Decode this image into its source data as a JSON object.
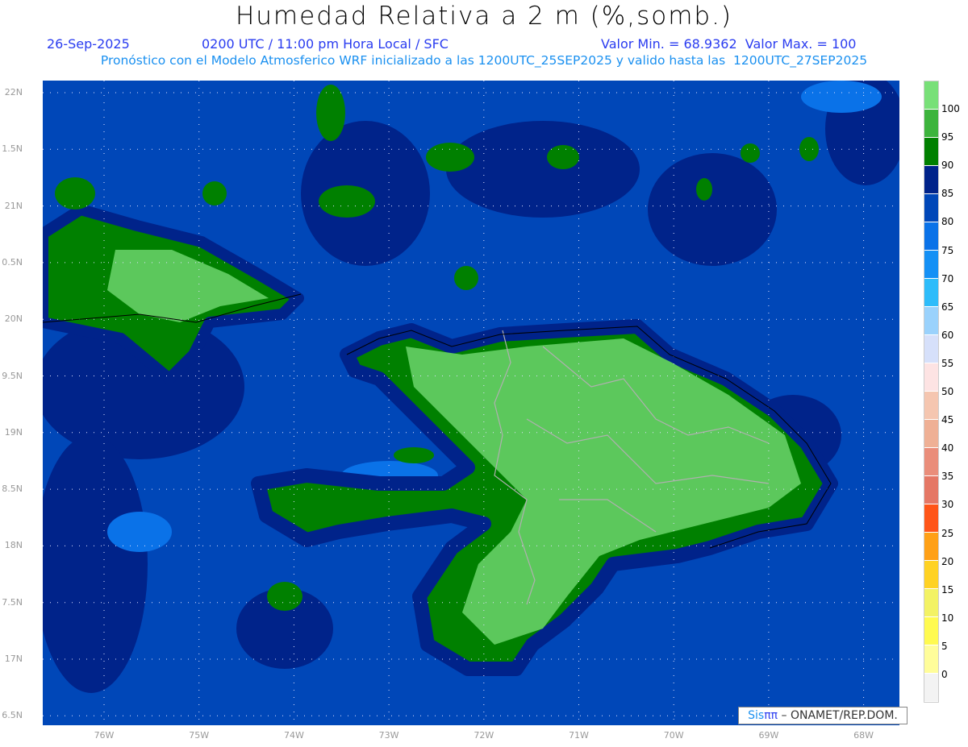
{
  "header": {
    "title": "Humedad Relativa a 2 m (%,somb.)",
    "date": "26-Sep-2025",
    "time": "0200 UTC / 11:00 pm Hora Local / SFC",
    "min_max": "Valor Min. = 68.9362  Valor Max. = 100",
    "model_info": "Pronóstico con el Modelo Atmosferico WRF inicializado a las 1200UTC_25SEP2025 y valido hasta las  1200UTC_27SEP2025"
  },
  "axes": {
    "lat_labels": [
      "22N",
      "1.5N",
      "21N",
      "0.5N",
      "20N",
      "9.5N",
      "19N",
      "8.5N",
      "18N",
      "7.5N",
      "17N",
      "6.5N"
    ],
    "lon_labels": [
      "76W",
      "75W",
      "74W",
      "73W",
      "72W",
      "71W",
      "70W",
      "69W",
      "68W"
    ]
  },
  "colorbar": {
    "labels": [
      "100",
      "95",
      "90",
      "85",
      "80",
      "75",
      "70",
      "65",
      "60",
      "55",
      "50",
      "45",
      "40",
      "35",
      "30",
      "25",
      "20",
      "15",
      "10",
      "5",
      "0"
    ],
    "colors": [
      "#78e078",
      "#3cb43c",
      "#008000",
      "#00238a",
      "#0047b8",
      "#0a72e8",
      "#1490f5",
      "#2dbcfa",
      "#9ad2fc",
      "#d6e0fa",
      "#fde3e3",
      "#f5c6b0",
      "#efb095",
      "#ea8d7a",
      "#e57765",
      "#ff5518",
      "#ffa016",
      "#ffd223",
      "#f3f264",
      "#fffa50",
      "#fffd9a",
      "#f3f3f3"
    ]
  },
  "logo": {
    "sis": "Sis",
    "pi": "ππ",
    "rest": " – ONAMET/REP.DOM."
  }
}
